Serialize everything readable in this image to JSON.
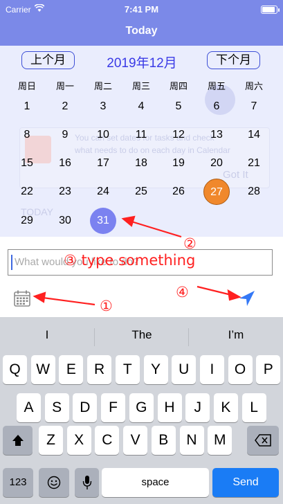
{
  "status": {
    "carrier": "Carrier",
    "time": "7:41 PM",
    "battery_level": 1.0
  },
  "nav": {
    "title": "Today"
  },
  "calendar": {
    "prev_label": "上个月",
    "next_label": "下个月",
    "month_title": "2019年12月",
    "weekdays": [
      "周日",
      "周一",
      "周二",
      "周三",
      "周四",
      "周五",
      "周六"
    ],
    "weeks": [
      [
        "1",
        "2",
        "3",
        "4",
        "5",
        "6",
        "7"
      ],
      [
        "8",
        "9",
        "10",
        "11",
        "12",
        "13",
        "14"
      ],
      [
        "15",
        "16",
        "17",
        "18",
        "19",
        "20",
        "21"
      ],
      [
        "22",
        "23",
        "24",
        "25",
        "26",
        "27",
        "28"
      ],
      [
        "29",
        "30",
        "31",
        "",
        "",
        "",
        ""
      ]
    ],
    "today": "27",
    "selected": "31",
    "today_color": "#f0882c",
    "selected_color": "#7b82f0"
  },
  "background_hint": {
    "line1": "You can set dates for tasks and check",
    "line2": "what needs to do on each day in Calendar",
    "got_it": "Got It",
    "today_label": "TODAY"
  },
  "composer": {
    "placeholder": "What would you like to do?",
    "annotation_text": "③ type something"
  },
  "annotations": {
    "one": "①",
    "two": "②",
    "four": "④",
    "color": "#ff2020"
  },
  "icons": {
    "calendar": "calendar-icon",
    "send": "send-arrow-icon"
  },
  "keyboard": {
    "suggestions": [
      "I",
      "The",
      "I’m"
    ],
    "row1": [
      "Q",
      "W",
      "E",
      "R",
      "T",
      "Y",
      "U",
      "I",
      "O",
      "P"
    ],
    "row2": [
      "A",
      "S",
      "D",
      "F",
      "G",
      "H",
      "J",
      "K",
      "L"
    ],
    "row3": [
      "Z",
      "X",
      "C",
      "V",
      "B",
      "N",
      "M"
    ],
    "numbers_label": "123",
    "space_label": "space",
    "send_label": "Send",
    "send_color": "#1a7cf5"
  },
  "colors": {
    "accent": "#7b89e8",
    "month_title": "#3a3ae6"
  }
}
